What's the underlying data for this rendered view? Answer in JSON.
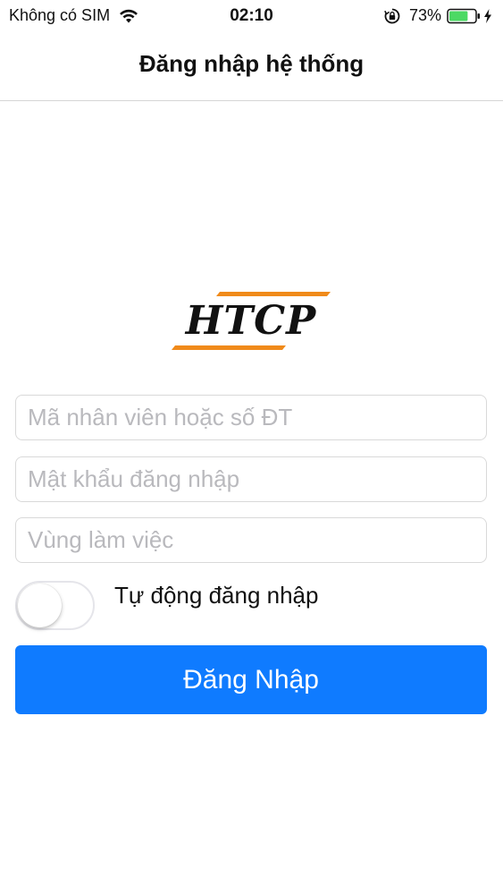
{
  "status_bar": {
    "carrier": "Không có SIM",
    "time": "02:10",
    "battery_percent": "73%",
    "battery_level": 0.73,
    "battery_color": "#4cd964"
  },
  "nav": {
    "title": "Đăng nhập hệ thống"
  },
  "logo": {
    "text": "HTCP",
    "accent_color": "#f08a1a"
  },
  "form": {
    "employee_placeholder": "Mã nhân viên hoặc số ĐT",
    "employee_value": "",
    "password_placeholder": "Mật khẩu đăng nhập",
    "password_value": "",
    "workspace_placeholder": "Vùng làm việc",
    "workspace_value": "",
    "auto_login_label": "Tự động đăng nhập",
    "auto_login_on": false,
    "login_label": "Đăng Nhập",
    "login_color": "#0f7bff"
  },
  "icons": {
    "wifi": "wifi-icon",
    "orientation_lock": "orientation-lock-icon",
    "battery": "battery-icon",
    "charging": "charging-bolt-icon"
  }
}
